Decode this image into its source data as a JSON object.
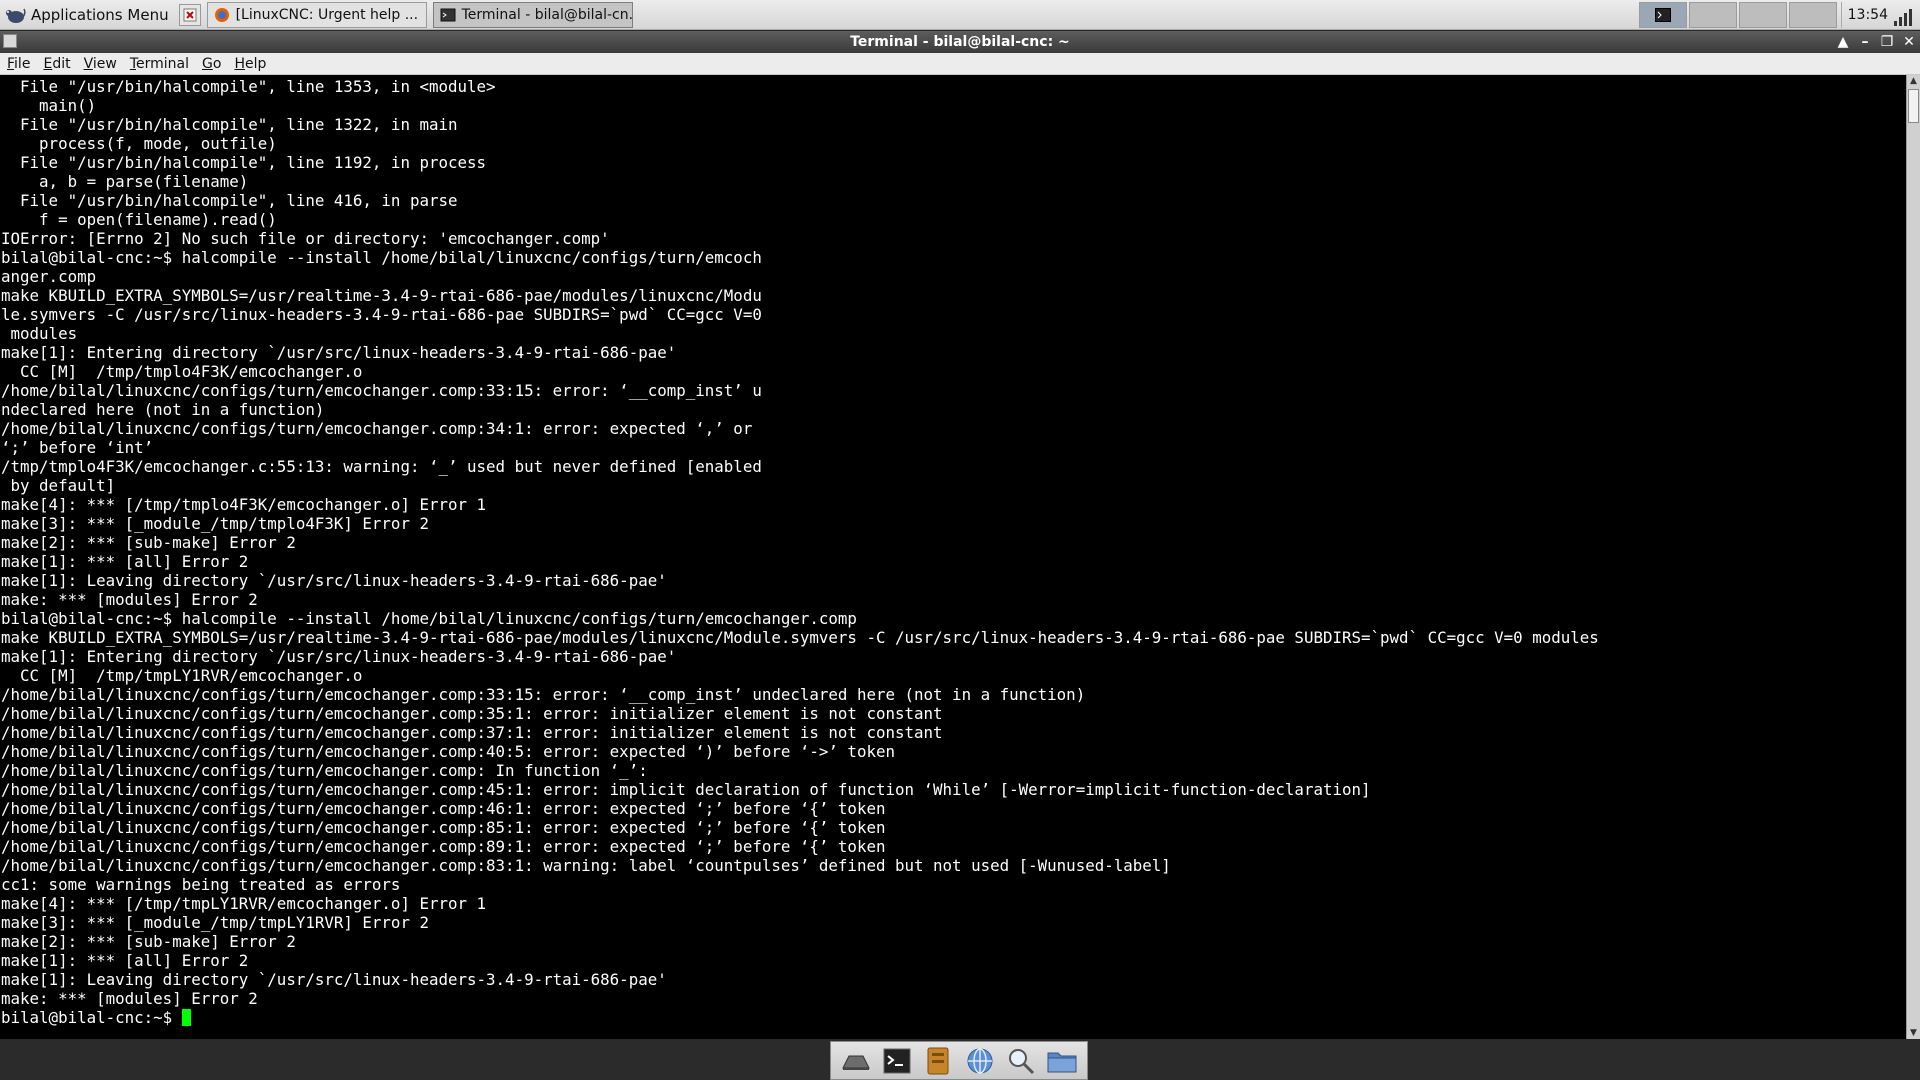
{
  "top_panel": {
    "apps_menu_label": "Applications Menu",
    "tasks": [
      {
        "label": "[LinuxCNC: Urgent help ..."
      },
      {
        "label": "Terminal - bilal@bilal-cn..."
      }
    ],
    "clock": "13:54"
  },
  "window": {
    "title": "Terminal - bilal@bilal-cnc: ~"
  },
  "menubar": {
    "items": [
      {
        "mn": "F",
        "rest": "ile"
      },
      {
        "mn": "E",
        "rest": "dit"
      },
      {
        "mn": "V",
        "rest": "iew"
      },
      {
        "mn": "T",
        "rest": "erminal"
      },
      {
        "mn": "G",
        "rest": "o"
      },
      {
        "mn": "H",
        "rest": "elp"
      }
    ]
  },
  "terminal": {
    "lines": [
      "  File \"/usr/bin/halcompile\", line 1353, in <module>",
      "    main()",
      "  File \"/usr/bin/halcompile\", line 1322, in main",
      "    process(f, mode, outfile)",
      "  File \"/usr/bin/halcompile\", line 1192, in process",
      "    a, b = parse(filename)",
      "  File \"/usr/bin/halcompile\", line 416, in parse",
      "    f = open(filename).read()",
      "IOError: [Errno 2] No such file or directory: 'emcochanger.comp'",
      "bilal@bilal-cnc:~$ halcompile --install /home/bilal/linuxcnc/configs/turn/emcoch",
      "anger.comp",
      "make KBUILD_EXTRA_SYMBOLS=/usr/realtime-3.4-9-rtai-686-pae/modules/linuxcnc/Modu",
      "le.symvers -C /usr/src/linux-headers-3.4-9-rtai-686-pae SUBDIRS=`pwd` CC=gcc V=0",
      " modules",
      "make[1]: Entering directory `/usr/src/linux-headers-3.4-9-rtai-686-pae'",
      "  CC [M]  /tmp/tmplo4F3K/emcochanger.o",
      "/home/bilal/linuxcnc/configs/turn/emcochanger.comp:33:15: error: ‘__comp_inst’ u",
      "ndeclared here (not in a function)",
      "/home/bilal/linuxcnc/configs/turn/emcochanger.comp:34:1: error: expected ‘,’ or",
      "‘;’ before ‘int’",
      "/tmp/tmplo4F3K/emcochanger.c:55:13: warning: ‘_’ used but never defined [enabled",
      " by default]",
      "make[4]: *** [/tmp/tmplo4F3K/emcochanger.o] Error 1",
      "make[3]: *** [_module_/tmp/tmplo4F3K] Error 2",
      "make[2]: *** [sub-make] Error 2",
      "make[1]: *** [all] Error 2",
      "make[1]: Leaving directory `/usr/src/linux-headers-3.4-9-rtai-686-pae'",
      "make: *** [modules] Error 2",
      "bilal@bilal-cnc:~$ halcompile --install /home/bilal/linuxcnc/configs/turn/emcochanger.comp",
      "make KBUILD_EXTRA_SYMBOLS=/usr/realtime-3.4-9-rtai-686-pae/modules/linuxcnc/Module.symvers -C /usr/src/linux-headers-3.4-9-rtai-686-pae SUBDIRS=`pwd` CC=gcc V=0 modules",
      "make[1]: Entering directory `/usr/src/linux-headers-3.4-9-rtai-686-pae'",
      "  CC [M]  /tmp/tmpLY1RVR/emcochanger.o",
      "/home/bilal/linuxcnc/configs/turn/emcochanger.comp:33:15: error: ‘__comp_inst’ undeclared here (not in a function)",
      "/home/bilal/linuxcnc/configs/turn/emcochanger.comp:35:1: error: initializer element is not constant",
      "/home/bilal/linuxcnc/configs/turn/emcochanger.comp:37:1: error: initializer element is not constant",
      "/home/bilal/linuxcnc/configs/turn/emcochanger.comp:40:5: error: expected ‘)’ before ‘->’ token",
      "/home/bilal/linuxcnc/configs/turn/emcochanger.comp: In function ‘_’:",
      "/home/bilal/linuxcnc/configs/turn/emcochanger.comp:45:1: error: implicit declaration of function ‘While’ [-Werror=implicit-function-declaration]",
      "/home/bilal/linuxcnc/configs/turn/emcochanger.comp:46:1: error: expected ‘;’ before ‘{’ token",
      "/home/bilal/linuxcnc/configs/turn/emcochanger.comp:85:1: error: expected ‘;’ before ‘{’ token",
      "/home/bilal/linuxcnc/configs/turn/emcochanger.comp:89:1: error: expected ‘;’ before ‘{’ token",
      "/home/bilal/linuxcnc/configs/turn/emcochanger.comp:83:1: warning: label ‘countpulses’ defined but not used [-Wunused-label]",
      "cc1: some warnings being treated as errors",
      "make[4]: *** [/tmp/tmpLY1RVR/emcochanger.o] Error 1",
      "make[3]: *** [_module_/tmp/tmpLY1RVR] Error 2",
      "make[2]: *** [sub-make] Error 2",
      "make[1]: *** [all] Error 2",
      "make[1]: Leaving directory `/usr/src/linux-headers-3.4-9-rtai-686-pae'",
      "make: *** [modules] Error 2"
    ],
    "prompt": "bilal@bilal-cnc:~$ ",
    "cursor_color": "#00ff00"
  },
  "dock": {
    "icons": [
      "show-desktop-icon",
      "terminal-icon",
      "file-manager-icon",
      "web-browser-icon",
      "search-icon",
      "folder-icon"
    ]
  },
  "colors": {
    "terminal_bg": "#000000",
    "terminal_fg": "#ffffff",
    "titlebar": "#4a4a4a"
  }
}
